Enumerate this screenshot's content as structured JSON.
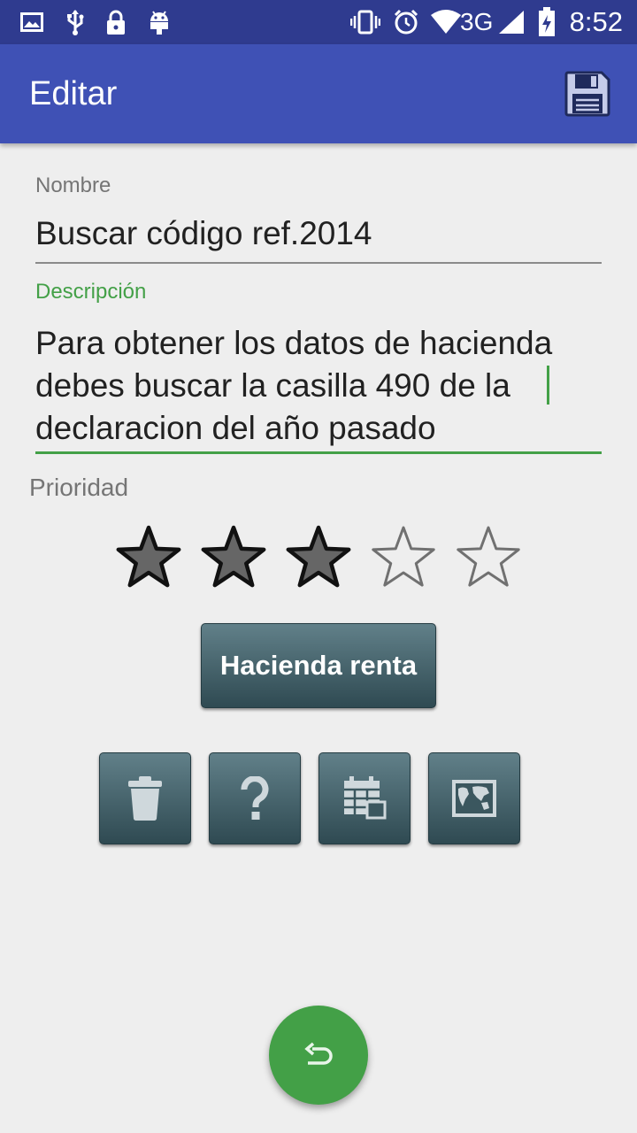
{
  "status_bar": {
    "time": "8:52",
    "network": "3G",
    "left_icons": [
      "image-icon",
      "usb-icon",
      "lock-icon",
      "android-icon"
    ],
    "right_icons": [
      "vibrate-icon",
      "alarm-icon",
      "wifi-icon",
      "signal-icon",
      "battery-charging-icon"
    ]
  },
  "appbar": {
    "title": "Editar",
    "save_icon": "save-icon"
  },
  "form": {
    "name_label": "Nombre",
    "name_value": "Buscar código ref.2014",
    "desc_label": "Descripción",
    "desc_value": "Para obtener los datos de hacienda debes buscar la casilla 490 de la declaracion del año pasado",
    "priority_label": "Prioridad"
  },
  "priority": {
    "value": 3,
    "max": 5
  },
  "category_button": "Hacienda renta",
  "actions": [
    "trash-icon",
    "help-icon",
    "calendar-icon",
    "map-icon"
  ],
  "fab_icon": "undo-icon",
  "colors": {
    "status_bar": "#2f3b8f",
    "app_bar": "#3f51b5",
    "accent": "#43a047",
    "button": "#3d5c65"
  }
}
